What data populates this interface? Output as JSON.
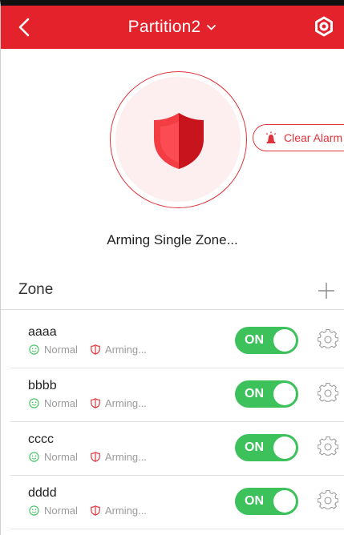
{
  "header": {
    "title": "Partition2",
    "back_icon": "chevron-left-icon",
    "dropdown_icon": "chevron-down-icon",
    "settings_icon": "gear-icon",
    "background_color": "#e3222b"
  },
  "arming": {
    "shield_icon": "shield-icon",
    "status_text": "Arming Single Zone...",
    "clear_alarm_label": "Clear Alarm",
    "clear_alarm_icon": "siren-icon",
    "accent_color": "#e0343c"
  },
  "zones": {
    "title": "Zone",
    "add_icon": "plus-icon",
    "items": [
      {
        "name": "aaaa",
        "status": "Normal",
        "arming": "Arming...",
        "toggle_label": "ON",
        "on": true
      },
      {
        "name": "bbbb",
        "status": "Normal",
        "arming": "Arming...",
        "toggle_label": "ON",
        "on": true
      },
      {
        "name": "cccc",
        "status": "Normal",
        "arming": "Arming...",
        "toggle_label": "ON",
        "on": true
      },
      {
        "name": "dddd",
        "status": "Normal",
        "arming": "Arming...",
        "toggle_label": "ON",
        "on": true
      }
    ],
    "toggle_color": "#3cc15b"
  }
}
